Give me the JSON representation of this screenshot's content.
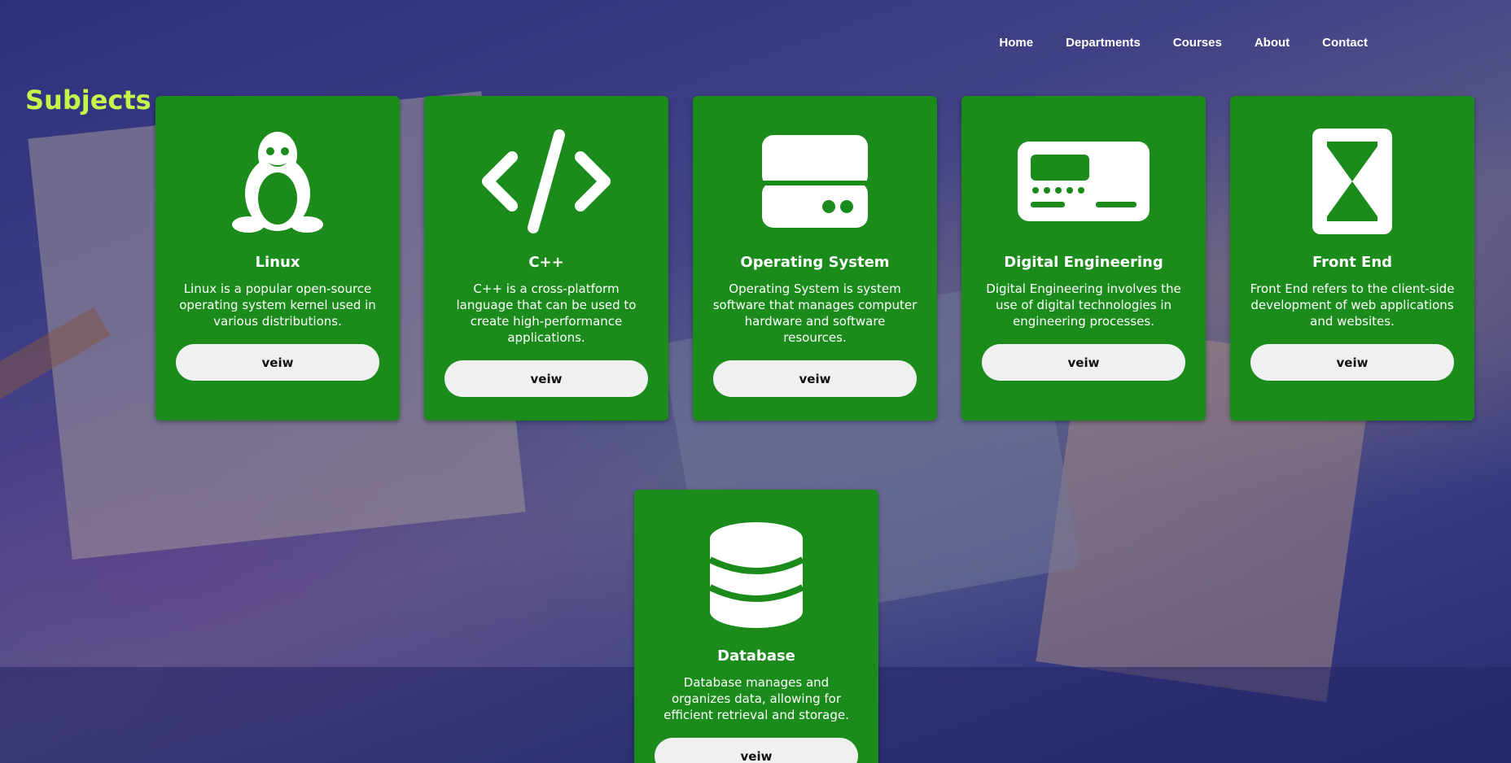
{
  "nav": {
    "items": [
      "Home",
      "Departments",
      "Courses",
      "About",
      "Contact"
    ]
  },
  "page_title": "Subjects",
  "colors": {
    "card_bg": "#1b8c1b",
    "title": "#c4f54a",
    "button_bg": "#f0f0f0"
  },
  "cards": [
    {
      "icon": "linux-penguin-icon",
      "title": "Linux",
      "description": "Linux is a popular open-source operating system kernel used in various distributions.",
      "button": "veiw"
    },
    {
      "icon": "code-icon",
      "title": "C++",
      "description": "C++ is a cross-platform language that can be used to create high-performance applications.",
      "button": "veiw"
    },
    {
      "icon": "server-icon",
      "title": "Operating System",
      "description": "Operating System is system software that manages computer hardware and software resources.",
      "button": "veiw"
    },
    {
      "icon": "keyboard-device-icon",
      "title": "Digital Engineering",
      "description": "Digital Engineering involves the use of digital technologies in engineering processes.",
      "button": "veiw"
    },
    {
      "icon": "hourglass-frame-icon",
      "title": "Front End",
      "description": "Front End refers to the client-side development of web applications and websites.",
      "button": "veiw"
    },
    {
      "icon": "database-icon",
      "title": "Database",
      "description": "Database manages and organizes data, allowing for efficient retrieval and storage.",
      "button": "veiw"
    }
  ]
}
